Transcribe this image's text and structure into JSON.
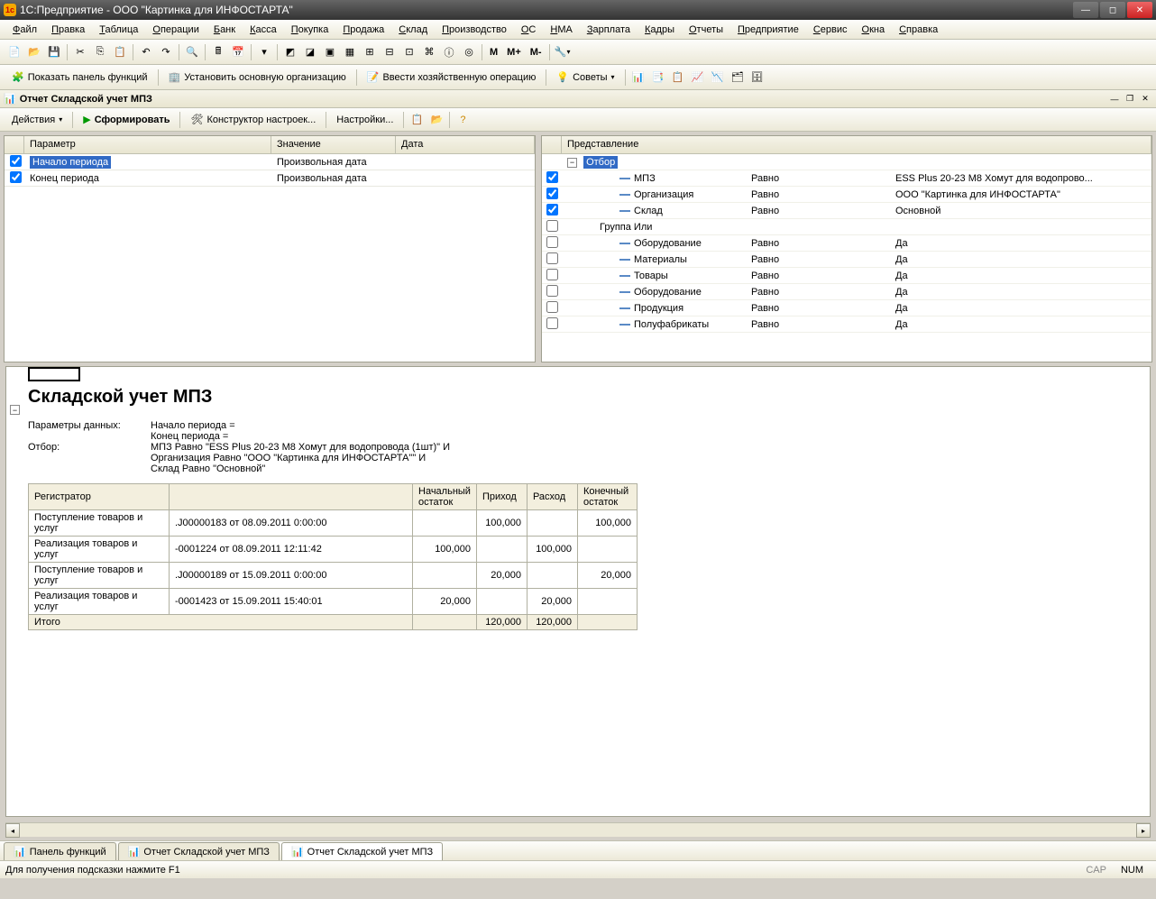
{
  "window": {
    "title": "1С:Предприятие - ООО \"Картинка для ИНФОСТАРТА\""
  },
  "menu": [
    "Файл",
    "Правка",
    "Таблица",
    "Операции",
    "Банк",
    "Касса",
    "Покупка",
    "Продажа",
    "Склад",
    "Производство",
    "ОС",
    "НМА",
    "Зарплата",
    "Кадры",
    "Отчеты",
    "Предприятие",
    "Сервис",
    "Окна",
    "Справка"
  ],
  "toolbar2": {
    "show_panel": "Показать панель функций",
    "set_org": "Установить основную организацию",
    "enter_op": "Ввести хозяйственную операцию",
    "tips": "Советы"
  },
  "doc": {
    "title": "Отчет  Складской учет МПЗ"
  },
  "report_toolbar": {
    "actions": "Действия",
    "generate": "Сформировать",
    "constructor": "Конструктор настроек...",
    "settings": "Настройки..."
  },
  "left_grid": {
    "headers": {
      "param": "Параметр",
      "value": "Значение",
      "date": "Дата"
    },
    "rows": [
      {
        "checked": true,
        "param": "Начало периода",
        "value": "Произвольная дата",
        "date": "",
        "selected": true
      },
      {
        "checked": true,
        "param": "Конец периода",
        "value": "Произвольная дата",
        "date": "",
        "selected": false
      }
    ]
  },
  "right_grid": {
    "header": "Представление",
    "root": "Отбор",
    "rows": [
      {
        "checked": true,
        "indent": 2,
        "dash": true,
        "field": "МПЗ",
        "cond": "Равно",
        "val": "ESS Plus 20-23 M8 Хомут для водопрово..."
      },
      {
        "checked": true,
        "indent": 2,
        "dash": true,
        "field": "Организация",
        "cond": "Равно",
        "val": "ООО \"Картинка для ИНФОСТАРТА\""
      },
      {
        "checked": true,
        "indent": 2,
        "dash": true,
        "field": "Склад",
        "cond": "Равно",
        "val": "Основной"
      },
      {
        "checked": false,
        "indent": 1,
        "dash": false,
        "field": "Группа Или",
        "cond": "",
        "val": ""
      },
      {
        "checked": false,
        "indent": 2,
        "dash": true,
        "field": "Оборудование",
        "cond": "Равно",
        "val": "Да"
      },
      {
        "checked": false,
        "indent": 2,
        "dash": true,
        "field": "Материалы",
        "cond": "Равно",
        "val": "Да"
      },
      {
        "checked": false,
        "indent": 2,
        "dash": true,
        "field": "Товары",
        "cond": "Равно",
        "val": "Да"
      },
      {
        "checked": false,
        "indent": 2,
        "dash": true,
        "field": "Оборудование",
        "cond": "Равно",
        "val": "Да"
      },
      {
        "checked": false,
        "indent": 2,
        "dash": true,
        "field": "Продукция",
        "cond": "Равно",
        "val": "Да"
      },
      {
        "checked": false,
        "indent": 2,
        "dash": true,
        "field": "Полуфабрикаты",
        "cond": "Равно",
        "val": "Да"
      }
    ]
  },
  "report": {
    "title": "Складской учет МПЗ",
    "meta_label_params": "Параметры данных:",
    "meta_start": "Начало периода =",
    "meta_end": "Конец периода =",
    "meta_label_filter": "Отбор:",
    "filter_line1": "МПЗ Равно \"ESS Plus 20-23 M8 Хомут для водопровода      (1шт)\" И",
    "filter_line2": "Организация Равно \"ООО \"Картинка для ИНФОСТАРТА\"\" И",
    "filter_line3": "Склад Равно \"Основной\"",
    "columns": [
      "Регистратор",
      "",
      "Начальный остаток",
      "Приход",
      "Расход",
      "Конечный остаток"
    ],
    "rows": [
      {
        "doc": "Поступление товаров и услуг",
        "ref": ".J00000183 от 08.09.2011 0:00:00",
        "c1": "",
        "c2": "100,000",
        "c3": "",
        "c4": "100,000"
      },
      {
        "doc": "Реализация товаров и услуг",
        "ref": "-0001224 от 08.09.2011 12:11:42",
        "c1": "100,000",
        "c2": "",
        "c3": "100,000",
        "c4": ""
      },
      {
        "doc": "Поступление товаров и услуг",
        "ref": ".J00000189 от 15.09.2011 0:00:00",
        "c1": "",
        "c2": "20,000",
        "c3": "",
        "c4": "20,000"
      },
      {
        "doc": "Реализация товаров и услуг",
        "ref": "-0001423 от 15.09.2011 15:40:01",
        "c1": "20,000",
        "c2": "",
        "c3": "20,000",
        "c4": ""
      }
    ],
    "total_label": "Итого",
    "totals": {
      "c1": "",
      "c2": "120,000",
      "c3": "120,000",
      "c4": ""
    }
  },
  "tabs": [
    {
      "label": "Панель функций",
      "active": false
    },
    {
      "label": "Отчет  Складской учет МПЗ",
      "active": false
    },
    {
      "label": "Отчет  Складской учет МПЗ",
      "active": true
    }
  ],
  "statusbar": {
    "hint": "Для получения подсказки нажмите F1",
    "cap": "CAP",
    "num": "NUM"
  },
  "m_buttons": [
    "M",
    "M+",
    "M-"
  ]
}
